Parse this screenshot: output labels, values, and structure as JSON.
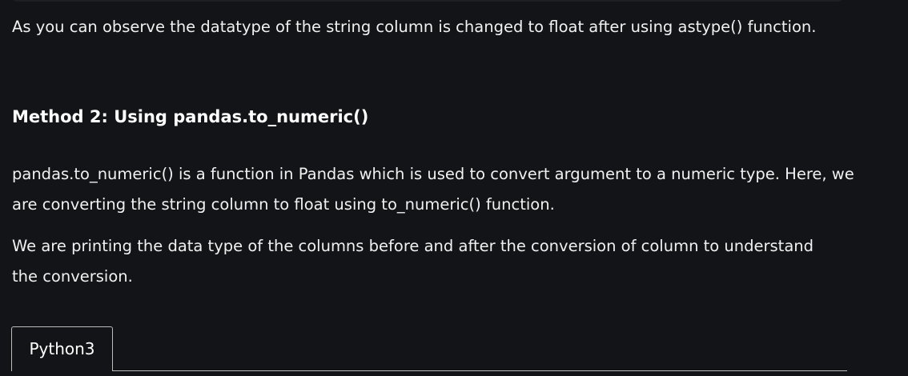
{
  "article": {
    "paragraph_1": "As you can observe the datatype of the string column is changed to float after using astype() function.",
    "heading_method_2": "Method 2: Using pandas.to_numeric()",
    "paragraph_2": "pandas.to_numeric() is a function in Pandas which is used to convert argument to a numeric type. Here, we are converting the string column to float using to_numeric() function.",
    "paragraph_3": "We are printing the data type of the columns before and after the conversion of column to understand the conversion."
  },
  "code_block": {
    "tabs": [
      {
        "label": "Python3"
      }
    ]
  },
  "colors": {
    "background": "#131417",
    "text": "#f1f1f1",
    "tab_border": "#bdbdbd"
  }
}
